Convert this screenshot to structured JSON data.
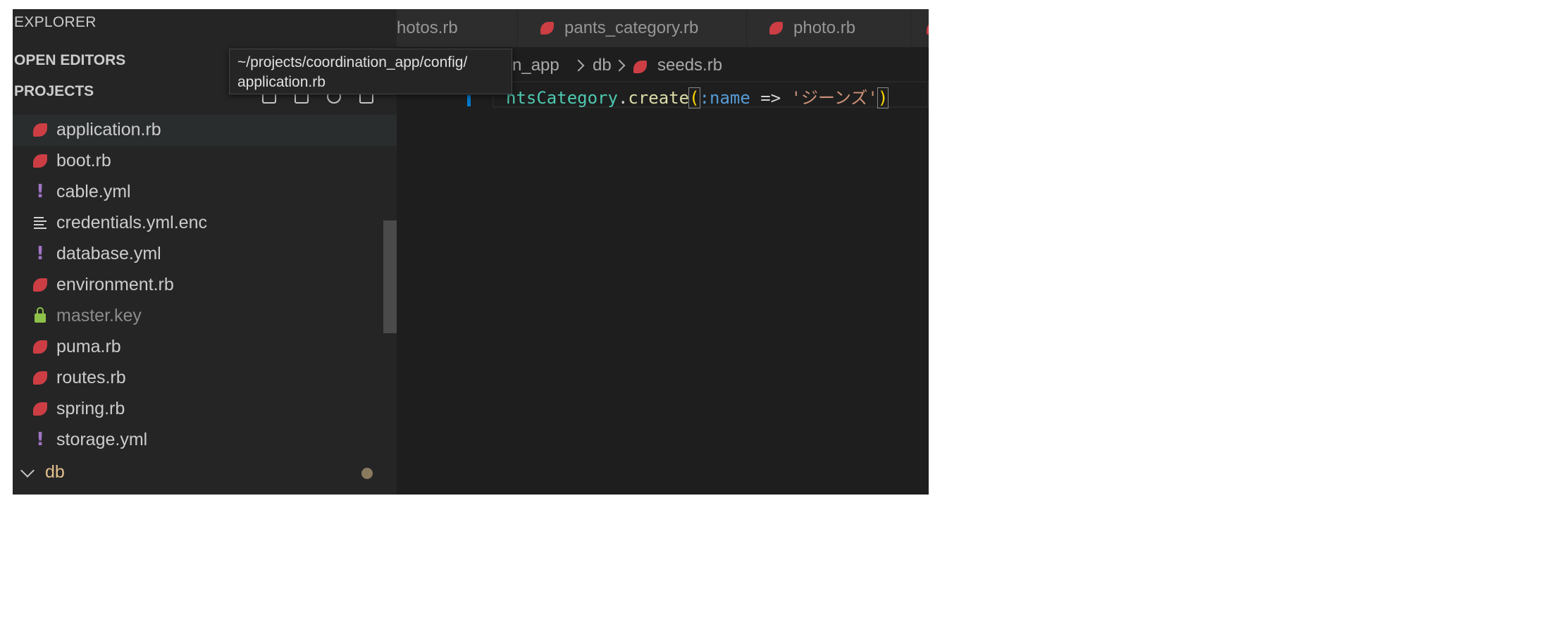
{
  "sidebar": {
    "title": "EXPLORER",
    "sections": {
      "open_editors": "OPEN EDITORS",
      "projects": "PROJECTS"
    },
    "files": [
      {
        "name": "application.rb",
        "icon": "ruby-file-icon",
        "selected": true
      },
      {
        "name": "boot.rb",
        "icon": "ruby-file-icon"
      },
      {
        "name": "cable.yml",
        "icon": "yaml-file-icon"
      },
      {
        "name": "credentials.yml.enc",
        "icon": "text-file-icon"
      },
      {
        "name": "database.yml",
        "icon": "yaml-file-icon"
      },
      {
        "name": "environment.rb",
        "icon": "ruby-file-icon"
      },
      {
        "name": "master.key",
        "icon": "lock-icon",
        "ignored": true
      },
      {
        "name": "puma.rb",
        "icon": "ruby-file-icon"
      },
      {
        "name": "routes.rb",
        "icon": "ruby-file-icon"
      },
      {
        "name": "spring.rb",
        "icon": "ruby-file-icon"
      },
      {
        "name": "storage.yml",
        "icon": "yaml-file-icon"
      }
    ],
    "folder": {
      "name": "db",
      "expanded": true
    }
  },
  "tooltip": {
    "line1": "~/projects/coordination_app/config/",
    "line2": "application.rb"
  },
  "tabs": [
    {
      "label": "hotos.rb"
    },
    {
      "label": "pants_category.rb"
    },
    {
      "label": "photo.rb"
    }
  ],
  "breadcrumb": {
    "part1": "n_app",
    "part2": "db",
    "file": "seeds.rb"
  },
  "editor": {
    "code": {
      "class_name": "ntsCategory",
      "dot": ".",
      "method": "create",
      "open_paren": "(",
      "symbol": ":name",
      "arrow": " => ",
      "string": "'ジーンズ'",
      "close_paren": ")"
    }
  },
  "colors": {
    "ruby_icon": "#cc3e44",
    "yaml_icon": "#a074c4",
    "lock_icon": "#8dc149",
    "folder_text": "#e2c08d",
    "accent": "#007acc"
  }
}
